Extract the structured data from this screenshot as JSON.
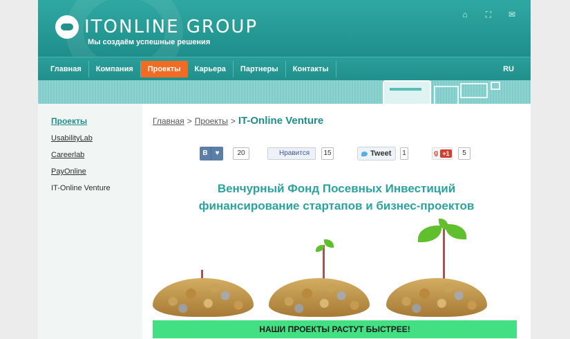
{
  "header": {
    "logo_text": "ITONLINE GROUP",
    "tagline": "Мы создаём успешные решения",
    "icons": [
      "home-icon",
      "sitemap-icon",
      "mail-icon"
    ]
  },
  "nav": {
    "items": [
      {
        "label": "Главная"
      },
      {
        "label": "Компания"
      },
      {
        "label": "Проекты"
      },
      {
        "label": "Карьера"
      },
      {
        "label": "Партнеры"
      },
      {
        "label": "Контакты"
      }
    ],
    "active_index": 2,
    "lang": "RU"
  },
  "sidebar": {
    "title": "Проекты",
    "items": [
      {
        "label": "UsabilityLab"
      },
      {
        "label": "Careerlab"
      },
      {
        "label": "PayOnline"
      },
      {
        "label": "IT-Online Venture"
      }
    ]
  },
  "breadcrumb": {
    "home": "Главная",
    "projects": "Проекты",
    "sep": ">",
    "current": "IT-Online Venture"
  },
  "social": {
    "vk_letter": "В",
    "vk_count": "20",
    "fb_label": "Нравится",
    "fb_count": "15",
    "tw_label": "Tweet",
    "tw_count": "1",
    "gp_label": "+1",
    "gp_count": "5"
  },
  "main": {
    "headline_line1": "Венчурный Фонд Посевных Инвестиций",
    "headline_line2": "финансирование стартапов и бизнес-проектов",
    "cta": "НАШИ ПРОЕКТЫ РАСТУТ БЫСТРЕЕ!"
  },
  "colors": {
    "brand_teal": "#21908c",
    "nav_active": "#f26b22",
    "cta_green": "#42e083"
  }
}
